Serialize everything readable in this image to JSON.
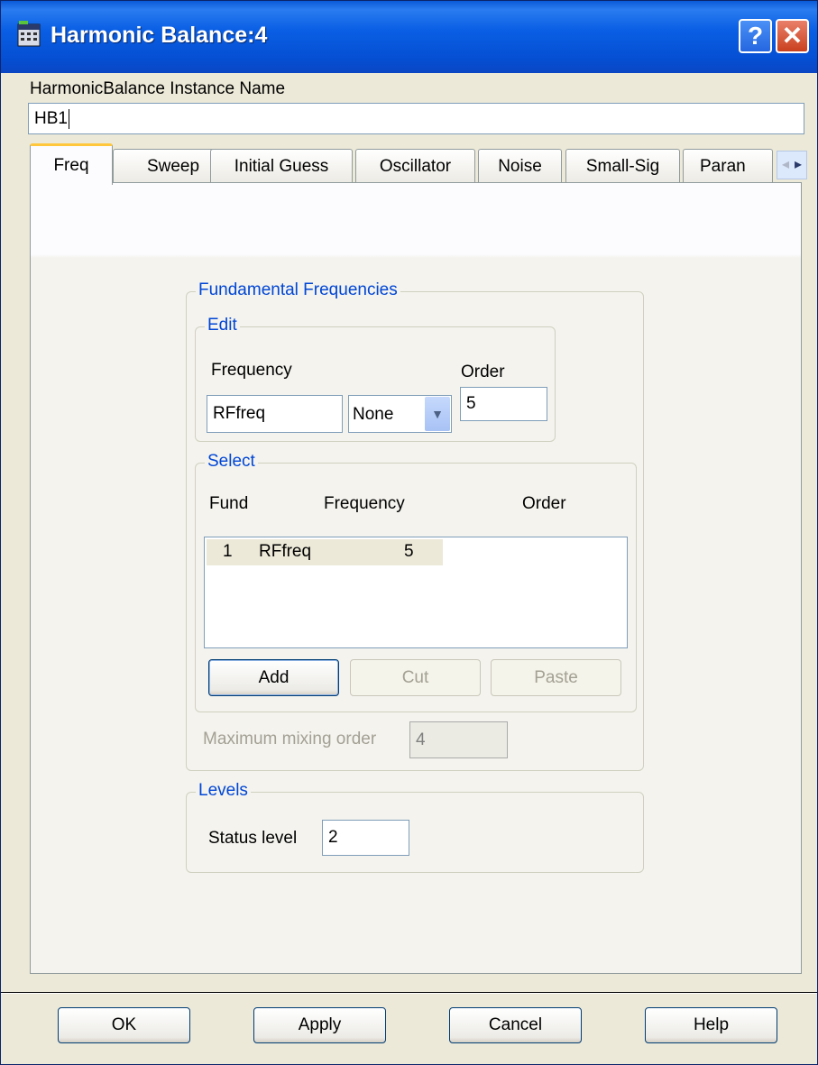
{
  "window": {
    "title": "Harmonic Balance:4",
    "help_button": "?",
    "close_button": "✕"
  },
  "instance": {
    "label": "HarmonicBalance Instance Name",
    "value": "HB1"
  },
  "tabs": [
    {
      "label": "Freq",
      "active": true
    },
    {
      "label": "Sweep"
    },
    {
      "label": "Initial Guess"
    },
    {
      "label": "Oscillator"
    },
    {
      "label": "Noise"
    },
    {
      "label": "Small-Sig"
    },
    {
      "label": "Paran"
    }
  ],
  "fundamental": {
    "legend": "Fundamental Frequencies",
    "edit": {
      "legend": "Edit",
      "frequency_label": "Frequency",
      "frequency_value": "RFfreq",
      "unit_value": "None",
      "order_label": "Order",
      "order_value": "5"
    },
    "select": {
      "legend": "Select",
      "col_fund": "Fund",
      "col_frequency": "Frequency",
      "col_order": "Order",
      "rows": [
        {
          "fund": "1",
          "frequency": "RFfreq",
          "order": "5"
        }
      ],
      "add_label": "Add",
      "cut_label": "Cut",
      "paste_label": "Paste"
    },
    "max_mixing_label": "Maximum mixing order",
    "max_mixing_value": "4"
  },
  "levels": {
    "legend": "Levels",
    "status_label": "Status level",
    "status_value": "2"
  },
  "footer": {
    "ok": "OK",
    "apply": "Apply",
    "cancel": "Cancel",
    "help": "Help"
  }
}
